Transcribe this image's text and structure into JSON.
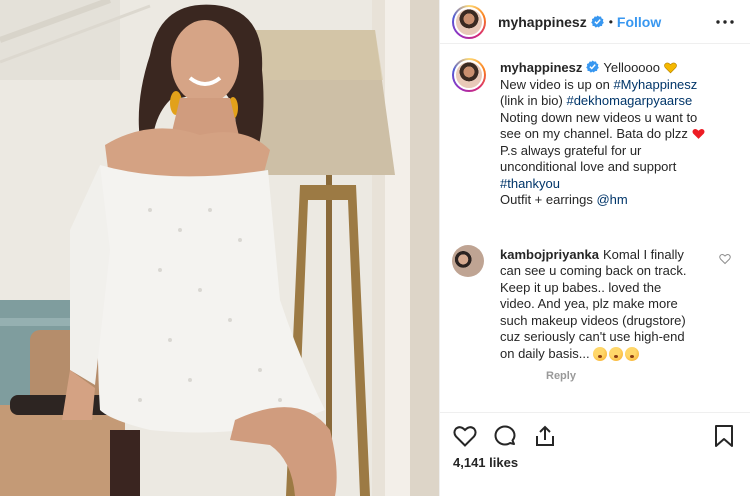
{
  "post": {
    "username": "myhappinesz",
    "follow_label": "Follow",
    "separator": "•",
    "verified": true
  },
  "caption": {
    "username": "myhappinesz",
    "lines": [
      "Yellooooo",
      "New video is up on ",
      "#Myhappinesz",
      "(link in bio) ",
      "#dekhomagarpyaarse",
      "Noting down new videos u want to",
      "see on my channel. Bata do plzz",
      "P.s always grateful for ur",
      "unconditional love and support",
      "#thankyou",
      "Outfit + earrings ",
      "@hm"
    ]
  },
  "comment": {
    "username": "kambojpriyanka",
    "lines": [
      "Komal I finally",
      "can see u coming back on track.",
      "Keep it up babes.. loved the",
      "video. And yea, plz make more",
      "such makeup videos (drugstore)",
      "cuz seriously can't use high-end",
      "on daily basis..."
    ],
    "reply_label": "Reply"
  },
  "stats": {
    "likes": "4,141 likes"
  },
  "icons": {
    "more": "more-options-icon",
    "like": "heart-icon",
    "comment": "comment-icon",
    "share": "share-icon",
    "save": "bookmark-icon",
    "verified": "verified-badge-icon"
  },
  "colors": {
    "link": "#3897f0",
    "hashtag": "#003569",
    "verified": "#3897f0",
    "heart_emoji": "#ed1c24",
    "yellow_heart": "#f5b800"
  }
}
